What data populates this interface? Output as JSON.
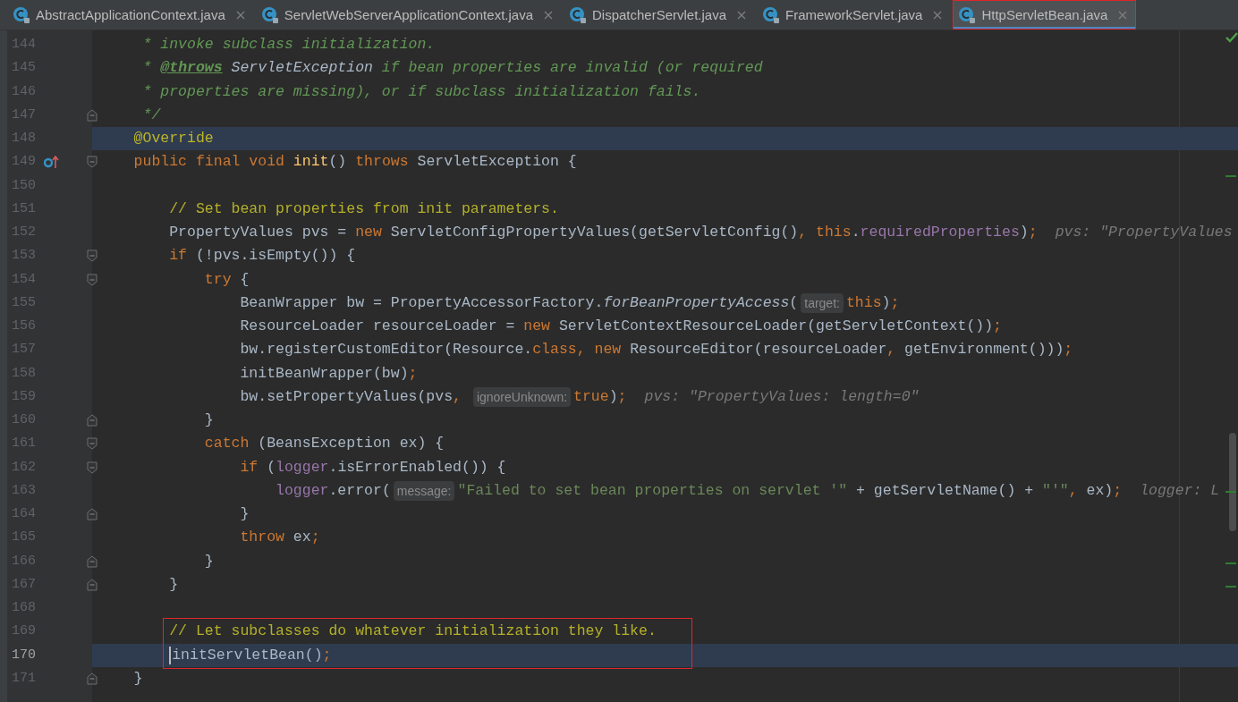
{
  "tabs": [
    {
      "label": "AbstractApplicationContext.java",
      "selected": false,
      "outlined": false
    },
    {
      "label": "ServletWebServerApplicationContext.java",
      "selected": false,
      "outlined": false
    },
    {
      "label": "DispatcherServlet.java",
      "selected": false,
      "outlined": false
    },
    {
      "label": "FrameworkServlet.java",
      "selected": false,
      "outlined": false
    },
    {
      "label": "HttpServletBean.java",
      "selected": true,
      "outlined": true
    }
  ],
  "lines": [
    {
      "number": "144",
      "highlighted": false,
      "current": false,
      "boxed": false,
      "tokens": [
        {
          "kind": "doc",
          "text": "     * invoke subclass initialization."
        }
      ]
    },
    {
      "number": "145",
      "highlighted": false,
      "current": false,
      "boxed": false,
      "tokens": [
        {
          "kind": "doc",
          "text": "     * "
        },
        {
          "kind": "doctag",
          "text": "@throws"
        },
        {
          "kind": "docref",
          "text": " ServletException"
        },
        {
          "kind": "doc",
          "text": " if bean properties are invalid (or required"
        }
      ]
    },
    {
      "number": "146",
      "highlighted": false,
      "current": false,
      "boxed": false,
      "tokens": [
        {
          "kind": "doc",
          "text": "     * properties are missing), or if subclass initialization fails."
        }
      ]
    },
    {
      "number": "147",
      "highlighted": false,
      "current": false,
      "boxed": false,
      "fold_marker": {
        "kind": "end"
      },
      "tokens": [
        {
          "kind": "doc",
          "text": "     */"
        }
      ]
    },
    {
      "number": "148",
      "highlighted": true,
      "current": false,
      "boxed": false,
      "tokens": [
        {
          "kind": "annotation",
          "text": "    @Override"
        }
      ]
    },
    {
      "number": "149",
      "highlighted": false,
      "current": false,
      "boxed": false,
      "fold_marker": {
        "kind": "start"
      },
      "gutter_marker": {
        "kind": "override"
      },
      "tokens": [
        {
          "kind": "keyword",
          "text": "    public final void "
        },
        {
          "kind": "declaration",
          "text": "init"
        },
        {
          "kind": "plain",
          "text": "() "
        },
        {
          "kind": "keyword",
          "text": "throws "
        },
        {
          "kind": "plain",
          "text": "ServletException {"
        }
      ]
    },
    {
      "number": "150",
      "highlighted": false,
      "current": false,
      "boxed": false
    },
    {
      "number": "151",
      "highlighted": false,
      "current": false,
      "boxed": false,
      "tokens": [
        {
          "kind": "comment",
          "text": "        // Set bean properties from init parameters."
        }
      ]
    },
    {
      "number": "152",
      "highlighted": false,
      "current": false,
      "boxed": false,
      "tokens": [
        {
          "kind": "plain",
          "text": "        PropertyValues pvs = "
        },
        {
          "kind": "keyword",
          "text": "new "
        },
        {
          "kind": "plain",
          "text": "ServletConfigPropertyValues(getServletConfig()"
        },
        {
          "kind": "punct",
          "text": ", "
        },
        {
          "kind": "keyword",
          "text": "this"
        },
        {
          "kind": "plain",
          "text": "."
        },
        {
          "kind": "field",
          "text": "requiredProperties"
        },
        {
          "kind": "plain",
          "text": ")"
        },
        {
          "kind": "punct",
          "text": ";"
        },
        {
          "kind": "value_hint",
          "text": "pvs: \"PropertyValues"
        }
      ]
    },
    {
      "number": "153",
      "highlighted": false,
      "current": false,
      "boxed": false,
      "fold_marker": {
        "kind": "start"
      },
      "tokens": [
        {
          "kind": "keyword",
          "text": "        if "
        },
        {
          "kind": "plain",
          "text": "(!pvs.isEmpty()) {"
        }
      ]
    },
    {
      "number": "154",
      "highlighted": false,
      "current": false,
      "boxed": false,
      "fold_marker": {
        "kind": "start"
      },
      "tokens": [
        {
          "kind": "keyword",
          "text": "            try "
        },
        {
          "kind": "plain",
          "text": "{"
        }
      ]
    },
    {
      "number": "155",
      "highlighted": false,
      "current": false,
      "boxed": false,
      "tokens": [
        {
          "kind": "plain",
          "text": "                BeanWrapper bw = PropertyAccessorFactory."
        },
        {
          "kind": "static",
          "text": "forBeanPropertyAccess"
        },
        {
          "kind": "plain",
          "text": "("
        },
        {
          "kind": "param_hint",
          "text": "target:"
        },
        {
          "kind": "keyword",
          "text": "this"
        },
        {
          "kind": "plain",
          "text": ")"
        },
        {
          "kind": "punct",
          "text": ";"
        }
      ]
    },
    {
      "number": "156",
      "highlighted": false,
      "current": false,
      "boxed": false,
      "tokens": [
        {
          "kind": "plain",
          "text": "                ResourceLoader resourceLoader = "
        },
        {
          "kind": "keyword",
          "text": "new "
        },
        {
          "kind": "plain",
          "text": "ServletContextResourceLoader(getServletContext())"
        },
        {
          "kind": "punct",
          "text": ";"
        }
      ]
    },
    {
      "number": "157",
      "highlighted": false,
      "current": false,
      "boxed": false,
      "tokens": [
        {
          "kind": "plain",
          "text": "                bw.registerCustomEditor(Resource."
        },
        {
          "kind": "keyword",
          "text": "class"
        },
        {
          "kind": "punct",
          "text": ", "
        },
        {
          "kind": "keyword",
          "text": "new "
        },
        {
          "kind": "plain",
          "text": "ResourceEditor(resourceLoader"
        },
        {
          "kind": "punct",
          "text": ", "
        },
        {
          "kind": "plain",
          "text": "getEnvironment()))"
        },
        {
          "kind": "punct",
          "text": ";"
        }
      ]
    },
    {
      "number": "158",
      "highlighted": false,
      "current": false,
      "boxed": false,
      "tokens": [
        {
          "kind": "plain",
          "text": "                initBeanWrapper(bw)"
        },
        {
          "kind": "punct",
          "text": ";"
        }
      ]
    },
    {
      "number": "159",
      "highlighted": false,
      "current": false,
      "boxed": false,
      "tokens": [
        {
          "kind": "plain",
          "text": "                bw.setPropertyValues(pvs"
        },
        {
          "kind": "punct",
          "text": ", "
        },
        {
          "kind": "param_hint",
          "text": "ignoreUnknown:"
        },
        {
          "kind": "keyword",
          "text": "true"
        },
        {
          "kind": "plain",
          "text": ")"
        },
        {
          "kind": "punct",
          "text": ";"
        },
        {
          "kind": "value_hint",
          "text": "pvs: \"PropertyValues: length=0\""
        }
      ]
    },
    {
      "number": "160",
      "highlighted": false,
      "current": false,
      "boxed": false,
      "fold_marker": {
        "kind": "end"
      },
      "tokens": [
        {
          "kind": "plain",
          "text": "            }"
        }
      ]
    },
    {
      "number": "161",
      "highlighted": false,
      "current": false,
      "boxed": false,
      "fold_marker": {
        "kind": "start"
      },
      "tokens": [
        {
          "kind": "keyword",
          "text": "            catch "
        },
        {
          "kind": "plain",
          "text": "(BeansException ex) {"
        }
      ]
    },
    {
      "number": "162",
      "highlighted": false,
      "current": false,
      "boxed": false,
      "fold_marker": {
        "kind": "start"
      },
      "tokens": [
        {
          "kind": "keyword",
          "text": "                if "
        },
        {
          "kind": "plain",
          "text": "("
        },
        {
          "kind": "field",
          "text": "logger"
        },
        {
          "kind": "plain",
          "text": ".isErrorEnabled()) {"
        }
      ]
    },
    {
      "number": "163",
      "highlighted": false,
      "current": false,
      "boxed": false,
      "tokens": [
        {
          "kind": "field",
          "text": "                    logger"
        },
        {
          "kind": "plain",
          "text": ".error("
        },
        {
          "kind": "param_hint",
          "text": "message:"
        },
        {
          "kind": "string",
          "text": "\"Failed to set bean properties on servlet '\""
        },
        {
          "kind": "plain",
          "text": " + getServletName() + "
        },
        {
          "kind": "string",
          "text": "\"'\""
        },
        {
          "kind": "punct",
          "text": ", "
        },
        {
          "kind": "plain",
          "text": "ex)"
        },
        {
          "kind": "punct",
          "text": ";"
        },
        {
          "kind": "value_hint",
          "text": "logger: L"
        }
      ]
    },
    {
      "number": "164",
      "highlighted": false,
      "current": false,
      "boxed": false,
      "fold_marker": {
        "kind": "end"
      },
      "tokens": [
        {
          "kind": "plain",
          "text": "                }"
        }
      ]
    },
    {
      "number": "165",
      "highlighted": false,
      "current": false,
      "boxed": false,
      "tokens": [
        {
          "kind": "keyword",
          "text": "                throw "
        },
        {
          "kind": "plain",
          "text": "ex"
        },
        {
          "kind": "punct",
          "text": ";"
        }
      ]
    },
    {
      "number": "166",
      "highlighted": false,
      "current": false,
      "boxed": false,
      "fold_marker": {
        "kind": "end"
      },
      "tokens": [
        {
          "kind": "plain",
          "text": "            }"
        }
      ]
    },
    {
      "number": "167",
      "highlighted": false,
      "current": false,
      "boxed": false,
      "fold_marker": {
        "kind": "end"
      },
      "tokens": [
        {
          "kind": "plain",
          "text": "        }"
        }
      ]
    },
    {
      "number": "168",
      "highlighted": false,
      "current": false,
      "boxed": false
    },
    {
      "number": "169",
      "highlighted": false,
      "current": false,
      "boxed": true,
      "tokens": [
        {
          "kind": "comment",
          "text": "        // Let subclasses do whatever initialization they like."
        }
      ]
    },
    {
      "number": "170",
      "highlighted": true,
      "current": true,
      "boxed": true,
      "tokens": [
        {
          "kind": "plain",
          "text": "        initServletBean()"
        },
        {
          "kind": "punct",
          "text": ";"
        }
      ]
    },
    {
      "number": "171",
      "highlighted": false,
      "current": false,
      "boxed": false,
      "fold_marker": {
        "kind": "end"
      },
      "tokens": [
        {
          "kind": "plain",
          "text": "    }"
        }
      ]
    }
  ]
}
